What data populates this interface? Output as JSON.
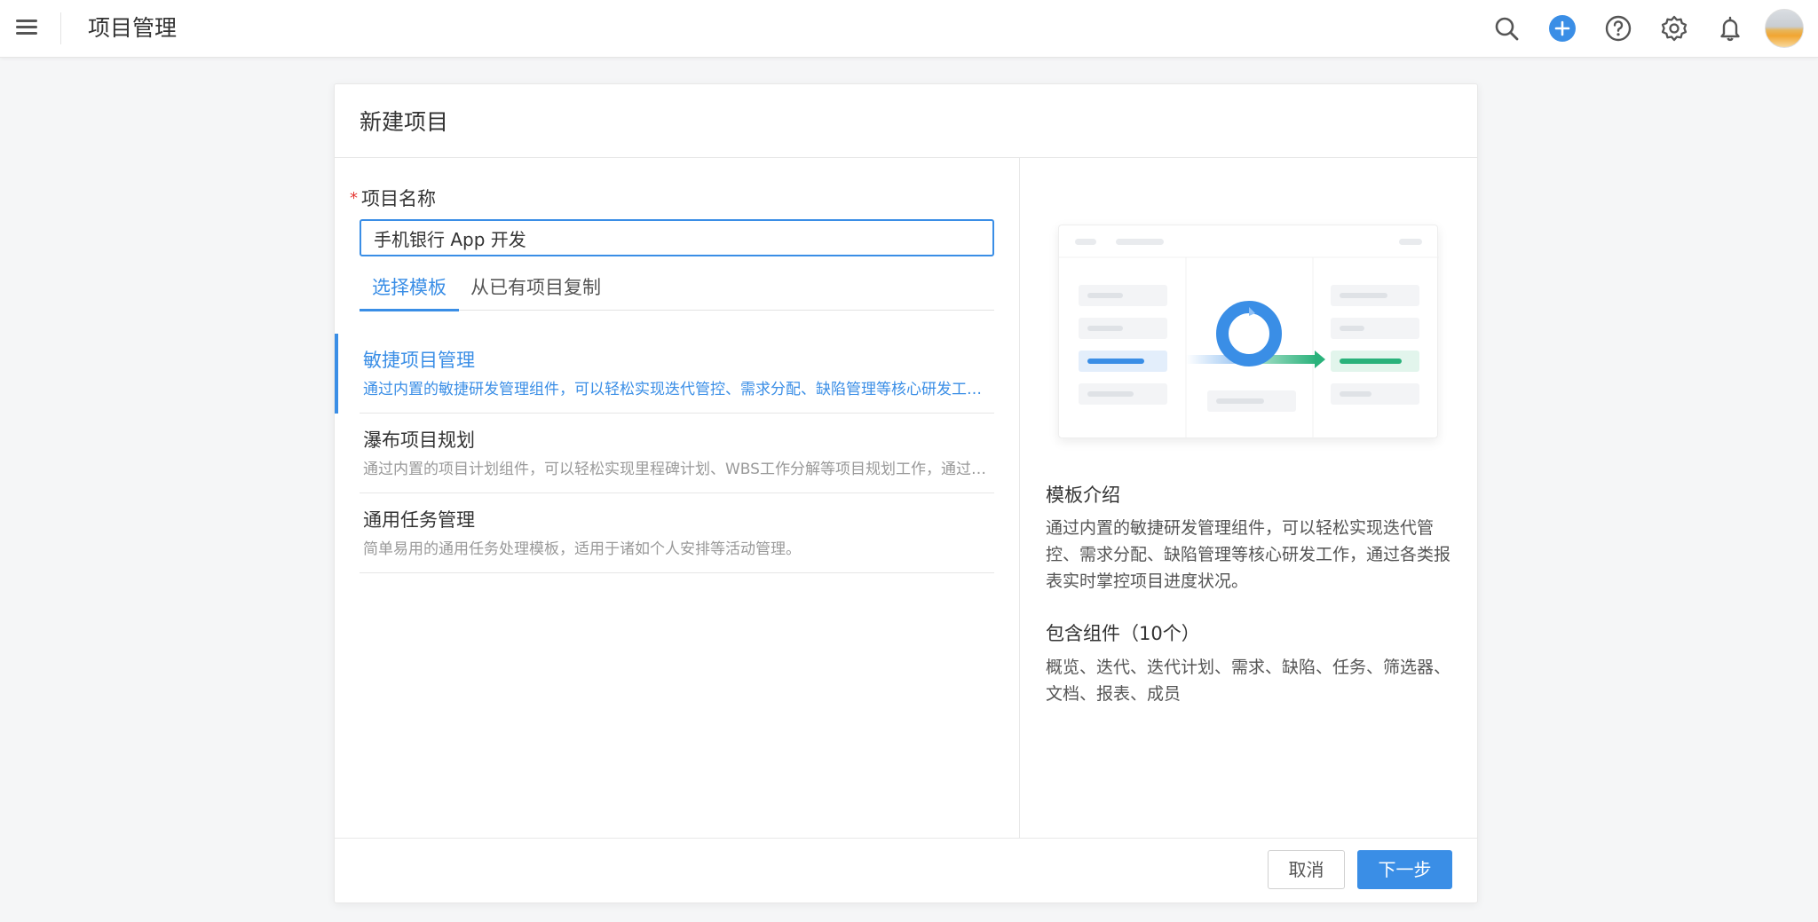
{
  "app": {
    "title": "项目管理"
  },
  "topbar": {
    "icons": [
      "search-icon",
      "add-icon",
      "help-icon",
      "settings-icon",
      "bell-icon"
    ],
    "accent": "#3a8ee6"
  },
  "dialog": {
    "title": "新建项目",
    "field_label": "项目名称",
    "required_mark": "*",
    "name_value": "手机银行 App 开发",
    "tabs": [
      {
        "label": "选择模板",
        "active": true
      },
      {
        "label": "从已有项目复制",
        "active": false
      }
    ],
    "templates": [
      {
        "name": "敏捷项目管理",
        "desc": "通过内置的敏捷研发管理组件，可以轻松实现迭代管控、需求分配、缺陷管理等核心研发工作，通过各类报表实时掌控项目进度状况。",
        "active": true
      },
      {
        "name": "瀑布项目规划",
        "desc": "通过内置的项目计划组件，可以轻松实现里程碑计划、WBS工作分解等项目规划工作，通过各类报表实时掌控项目进度状况。",
        "active": false
      },
      {
        "name": "通用任务管理",
        "desc": "简单易用的通用任务处理模板，适用于诸如个人安排等活动管理。",
        "active": false
      }
    ],
    "intro_title": "模板介绍",
    "intro_text": "通过内置的敏捷研发管理组件，可以轻松实现迭代管控、需求分配、缺陷管理等核心研发工作，通过各类报表实时掌控项目进度状况。",
    "components_title": "包含组件（10个）",
    "components_text": "概览、迭代、迭代计划、需求、缺陷、任务、筛选器、文档、报表、成员",
    "cancel_label": "取消",
    "next_label": "下一步"
  }
}
